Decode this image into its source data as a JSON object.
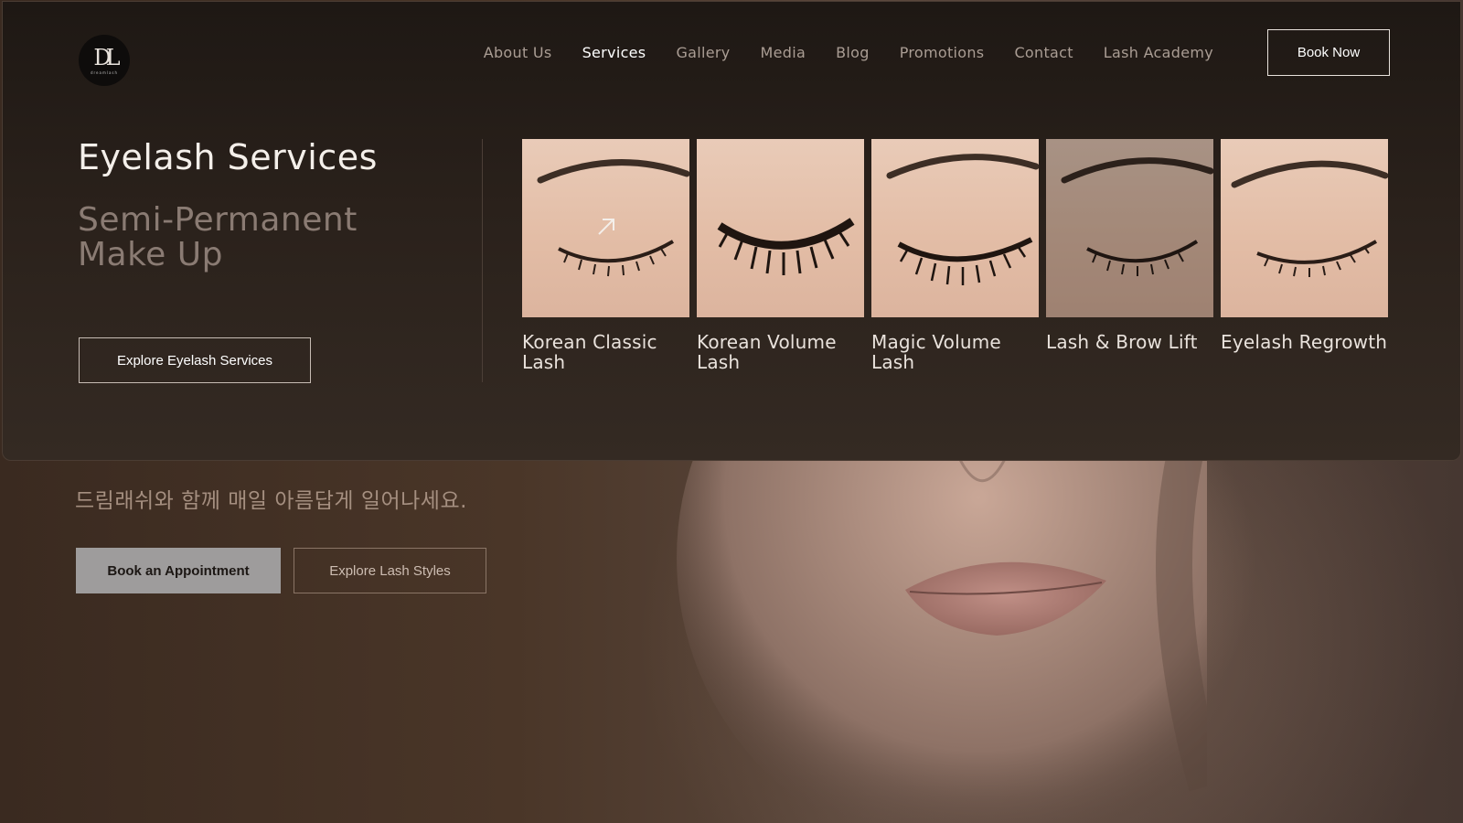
{
  "header": {
    "logo_mark": "DL",
    "logo_sub": "dreamlash",
    "nav": [
      {
        "label": "About Us",
        "active": false
      },
      {
        "label": "Services",
        "active": true
      },
      {
        "label": "Gallery",
        "active": false
      },
      {
        "label": "Media",
        "active": false
      },
      {
        "label": "Blog",
        "active": false
      },
      {
        "label": "Promotions",
        "active": false
      },
      {
        "label": "Contact",
        "active": false
      },
      {
        "label": "Lash Academy",
        "active": false
      }
    ],
    "book_now": "Book Now"
  },
  "menu": {
    "title": "Eyelash Services",
    "subtitle": "Semi-Permanent Make Up",
    "explore_button": "Explore Eyelash Services",
    "cards": [
      {
        "label": "Korean Classic Lash",
        "icon": "eye-closed-image"
      },
      {
        "label": "Korean Volume Lash",
        "icon": "eye-closed-image"
      },
      {
        "label": "Magic Volume Lash",
        "icon": "eye-closed-image"
      },
      {
        "label": "Lash & Brow Lift",
        "icon": "eye-closed-image",
        "hovered": true
      },
      {
        "label": "Eyelash Regrowth",
        "icon": "eye-closed-image"
      }
    ]
  },
  "hero": {
    "tagline": "드림래쉬와 함께 매일 아름답게 일어나세요.",
    "primary_button": "Book an Appointment",
    "secondary_button": "Explore Lash Styles"
  },
  "colors": {
    "background": "#2a211b",
    "panel": "#1e1814",
    "primary_button_bg": "#9e9c9c",
    "accent_text": "#a58f80"
  }
}
